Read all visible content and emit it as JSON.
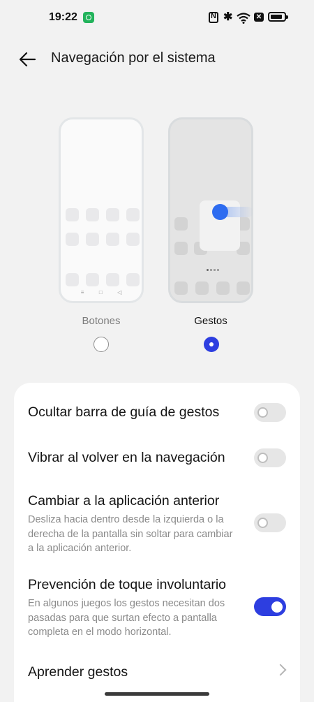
{
  "status_bar": {
    "time": "19:22"
  },
  "header": {
    "title": "Navegación por el sistema"
  },
  "nav_options": [
    {
      "label": "Botones",
      "selected": false
    },
    {
      "label": "Gestos",
      "selected": true
    }
  ],
  "settings": [
    {
      "title": "Ocultar barra de guía de gestos",
      "description": "",
      "enabled": false
    },
    {
      "title": "Vibrar al volver en la navegación",
      "description": "",
      "enabled": false
    },
    {
      "title": "Cambiar a la aplicación anterior",
      "description": "Desliza hacia dentro desde la izquierda o la derecha de la pantalla sin soltar para cambiar a la aplicación anterior.",
      "enabled": false
    },
    {
      "title": "Prevención de toque involuntario",
      "description": "En algunos juegos los gestos necesitan dos pasadas para que surtan efecto a pantalla completa en el modo horizontal.",
      "enabled": true
    },
    {
      "title": "Aprender gestos"
    }
  ],
  "colors": {
    "accent": "#2d3ee0",
    "background": "#f2f2f2",
    "card": "#ffffff"
  },
  "icons": [
    "wechat-notification-icon",
    "nfc-icon",
    "bluetooth-icon",
    "wifi-icon",
    "no-sim-icon",
    "battery-icon",
    "back-arrow-icon",
    "chevron-right-icon"
  ]
}
